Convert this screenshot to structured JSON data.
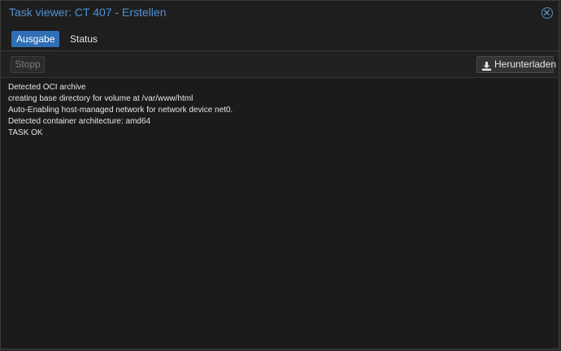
{
  "window": {
    "title": "Task viewer: CT 407 - Erstellen"
  },
  "tabs": [
    {
      "label": "Ausgabe",
      "active": true
    },
    {
      "label": "Status",
      "active": false
    }
  ],
  "toolbar": {
    "stop_label": "Stopp",
    "stop_enabled": false,
    "download_label": "Herunterladen"
  },
  "log": {
    "lines": [
      "Detected OCI archive",
      "creating base directory for volume at /var/www/html",
      "Auto-Enabling host-managed network for network device net0.",
      "Detected container architecture: amd64",
      "TASK OK"
    ]
  },
  "colors": {
    "accent": "#2f6fb6",
    "title": "#4f92d3",
    "background": "#1b1b1b"
  }
}
